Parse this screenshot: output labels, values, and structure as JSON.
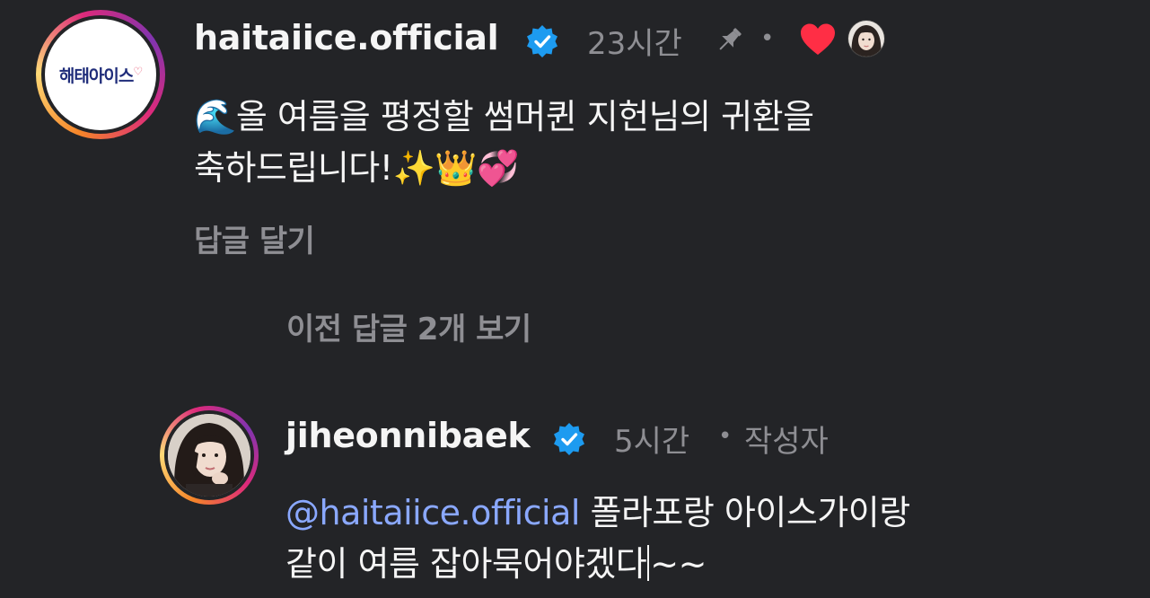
{
  "comment": {
    "avatar_logo_text": "해태아이스",
    "username": "haitaiice.official",
    "time": "23시간",
    "separator": "•",
    "text_line1": "올 여름을 평정할 썸머퀸 지헌님의 귀환을",
    "text_line2_prefix": "축하드립니다!",
    "emoji_lead": "🌊",
    "emoji_tail": "✨👑💞",
    "reply_action": "답글 달기",
    "icons": [
      "verified-badge-icon",
      "pin-icon",
      "heart-icon",
      "liker-avatar-icon"
    ],
    "colors": {
      "verified": "#1d9bf0",
      "heart": "#ff2e45"
    }
  },
  "view_previous": "이전 답글 2개 보기",
  "reply": {
    "username": "jiheonnibaek",
    "time": "5시간",
    "separator": "•",
    "author_badge": "작성자",
    "mention": "@haitaiice.official",
    "text_line1_rest": " 폴라포랑 아이스가이랑",
    "text_line2_a": "같이 여름 잡아묵어야겠다",
    "text_line2_b": "~~",
    "icons": [
      "verified-badge-icon"
    ],
    "colors": {
      "mention": "#8aa8ff"
    }
  }
}
